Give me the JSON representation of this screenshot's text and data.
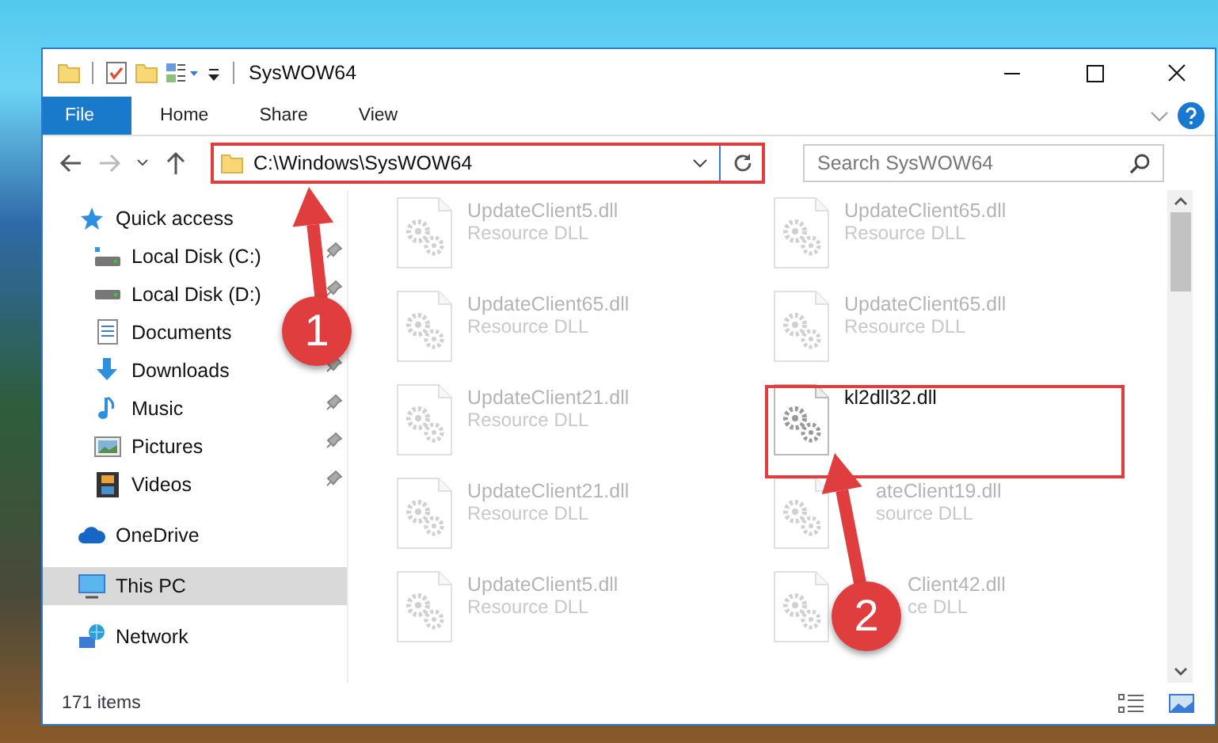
{
  "window": {
    "title": "SysWOW64"
  },
  "ribbon_tabs": [
    {
      "label": "File",
      "kind": "file",
      "selected": false
    },
    {
      "label": "Home",
      "kind": "tab",
      "selected": false
    },
    {
      "label": "Share",
      "kind": "tab",
      "selected": false
    },
    {
      "label": "View",
      "kind": "tab",
      "selected": false
    }
  ],
  "address_bar": {
    "path": "C:\\Windows\\SysWOW64"
  },
  "search": {
    "placeholder": "Search SysWOW64"
  },
  "sidebar": {
    "items": [
      {
        "label": "Quick access",
        "kind": "star",
        "selected": false,
        "children": [
          {
            "label": "Local Disk (C:)",
            "kind": "drive-c",
            "pinned": true,
            "selected": false
          },
          {
            "label": "Local Disk (D:)",
            "kind": "drive",
            "pinned": true,
            "selected": false
          },
          {
            "label": "Documents",
            "kind": "document",
            "selected": false
          },
          {
            "label": "Downloads",
            "kind": "download",
            "pinned": true,
            "selected": false
          },
          {
            "label": "Music",
            "kind": "music",
            "pinned": true,
            "selected": false
          },
          {
            "label": "Pictures",
            "kind": "picture",
            "pinned": true,
            "selected": false
          },
          {
            "label": "Videos",
            "kind": "video",
            "pinned": true,
            "selected": false
          }
        ]
      },
      {
        "label": "OneDrive",
        "kind": "cloud",
        "selected": false
      },
      {
        "label": "This PC",
        "kind": "computer",
        "selected": true
      },
      {
        "label": "Network",
        "kind": "network",
        "selected": false
      }
    ]
  },
  "files": [
    {
      "name": "UpdateClient5.dll",
      "type": "Resource DLL",
      "blurred": true
    },
    {
      "name": "UpdateClient65.dll",
      "type": "Resource DLL",
      "blurred": true
    },
    {
      "name": "UpdateClient65.dll",
      "type": "Resource DLL",
      "blurred": true
    },
    {
      "name": "UpdateClient65.dll",
      "type": "Resource DLL",
      "blurred": true
    },
    {
      "name": "UpdateClient21.dll",
      "type": "Resource DLL",
      "blurred": true
    },
    {
      "name": "kl2dll32.dll",
      "blurred": false
    },
    {
      "name": "UpdateClient21.dll",
      "type": "Resource DLL",
      "blurred": true
    },
    {
      "name": "ateClient19.dll",
      "type": "source DLL",
      "blurred": true,
      "kind": "arrow-covered"
    },
    {
      "name": "UpdateClient5.dll",
      "type": "Resource DLL",
      "blurred": true
    },
    {
      "name": "Client42.dll",
      "type": "ce DLL",
      "blurred": true,
      "kind": "badge-covered"
    }
  ],
  "status_bar": {
    "item_count": "171 items"
  },
  "annotations": [
    {
      "number": "1"
    },
    {
      "number": "2"
    }
  ]
}
